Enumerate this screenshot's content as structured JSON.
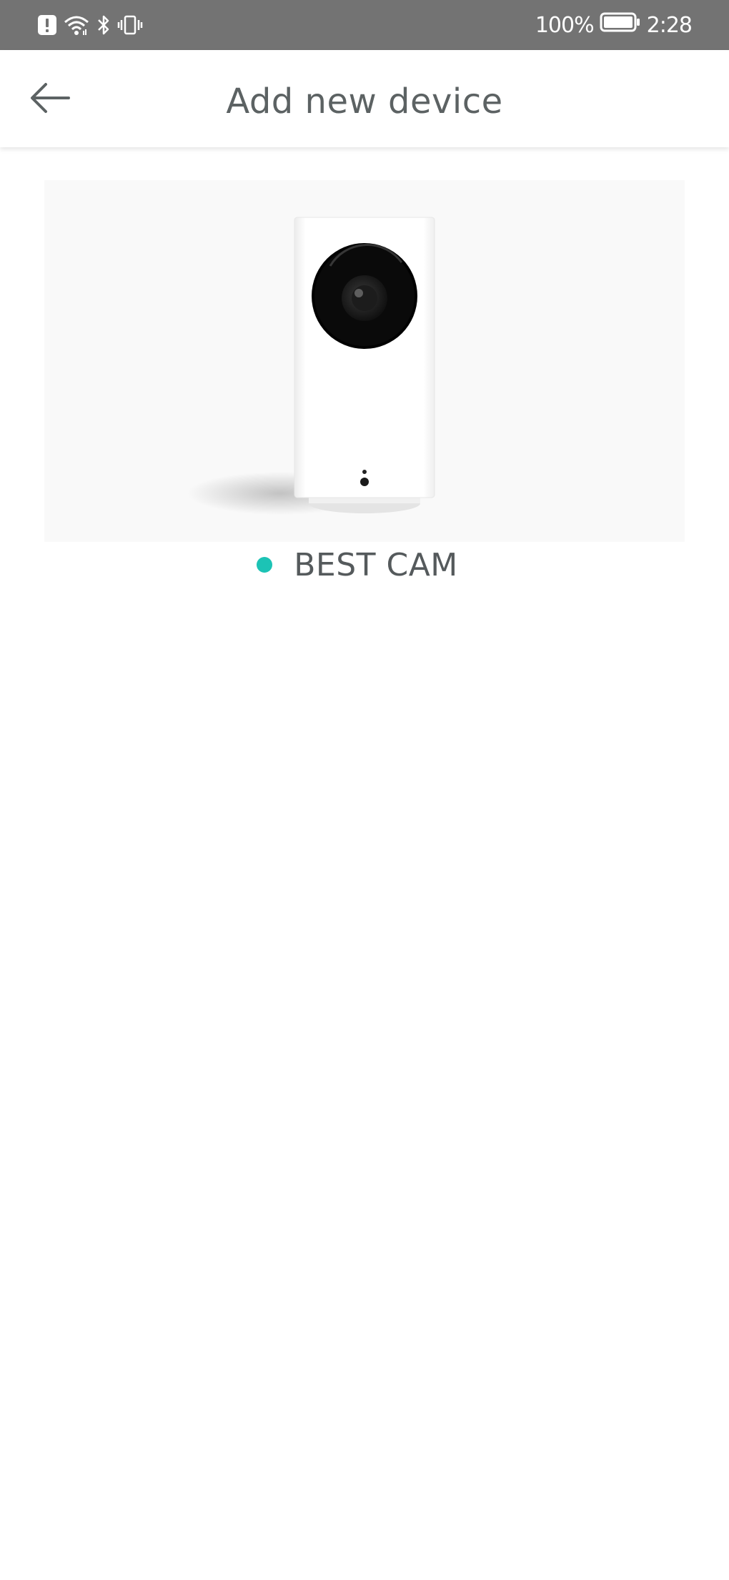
{
  "status_bar": {
    "battery_percent": "100%",
    "battery_level": 1.0,
    "time": "2:28",
    "icons": [
      "alert-icon",
      "wifi-icon",
      "bluetooth-icon",
      "vibrate-icon",
      "battery-icon"
    ]
  },
  "header": {
    "title": "Add new device",
    "back_icon": "arrow-left-icon"
  },
  "device": {
    "name": "BEST CAM",
    "status_color": "#1cc3b5",
    "image": "camera-image"
  },
  "colors": {
    "status_bar_bg": "#737373",
    "title_text": "#5c6263",
    "accent": "#1cc3b5"
  }
}
